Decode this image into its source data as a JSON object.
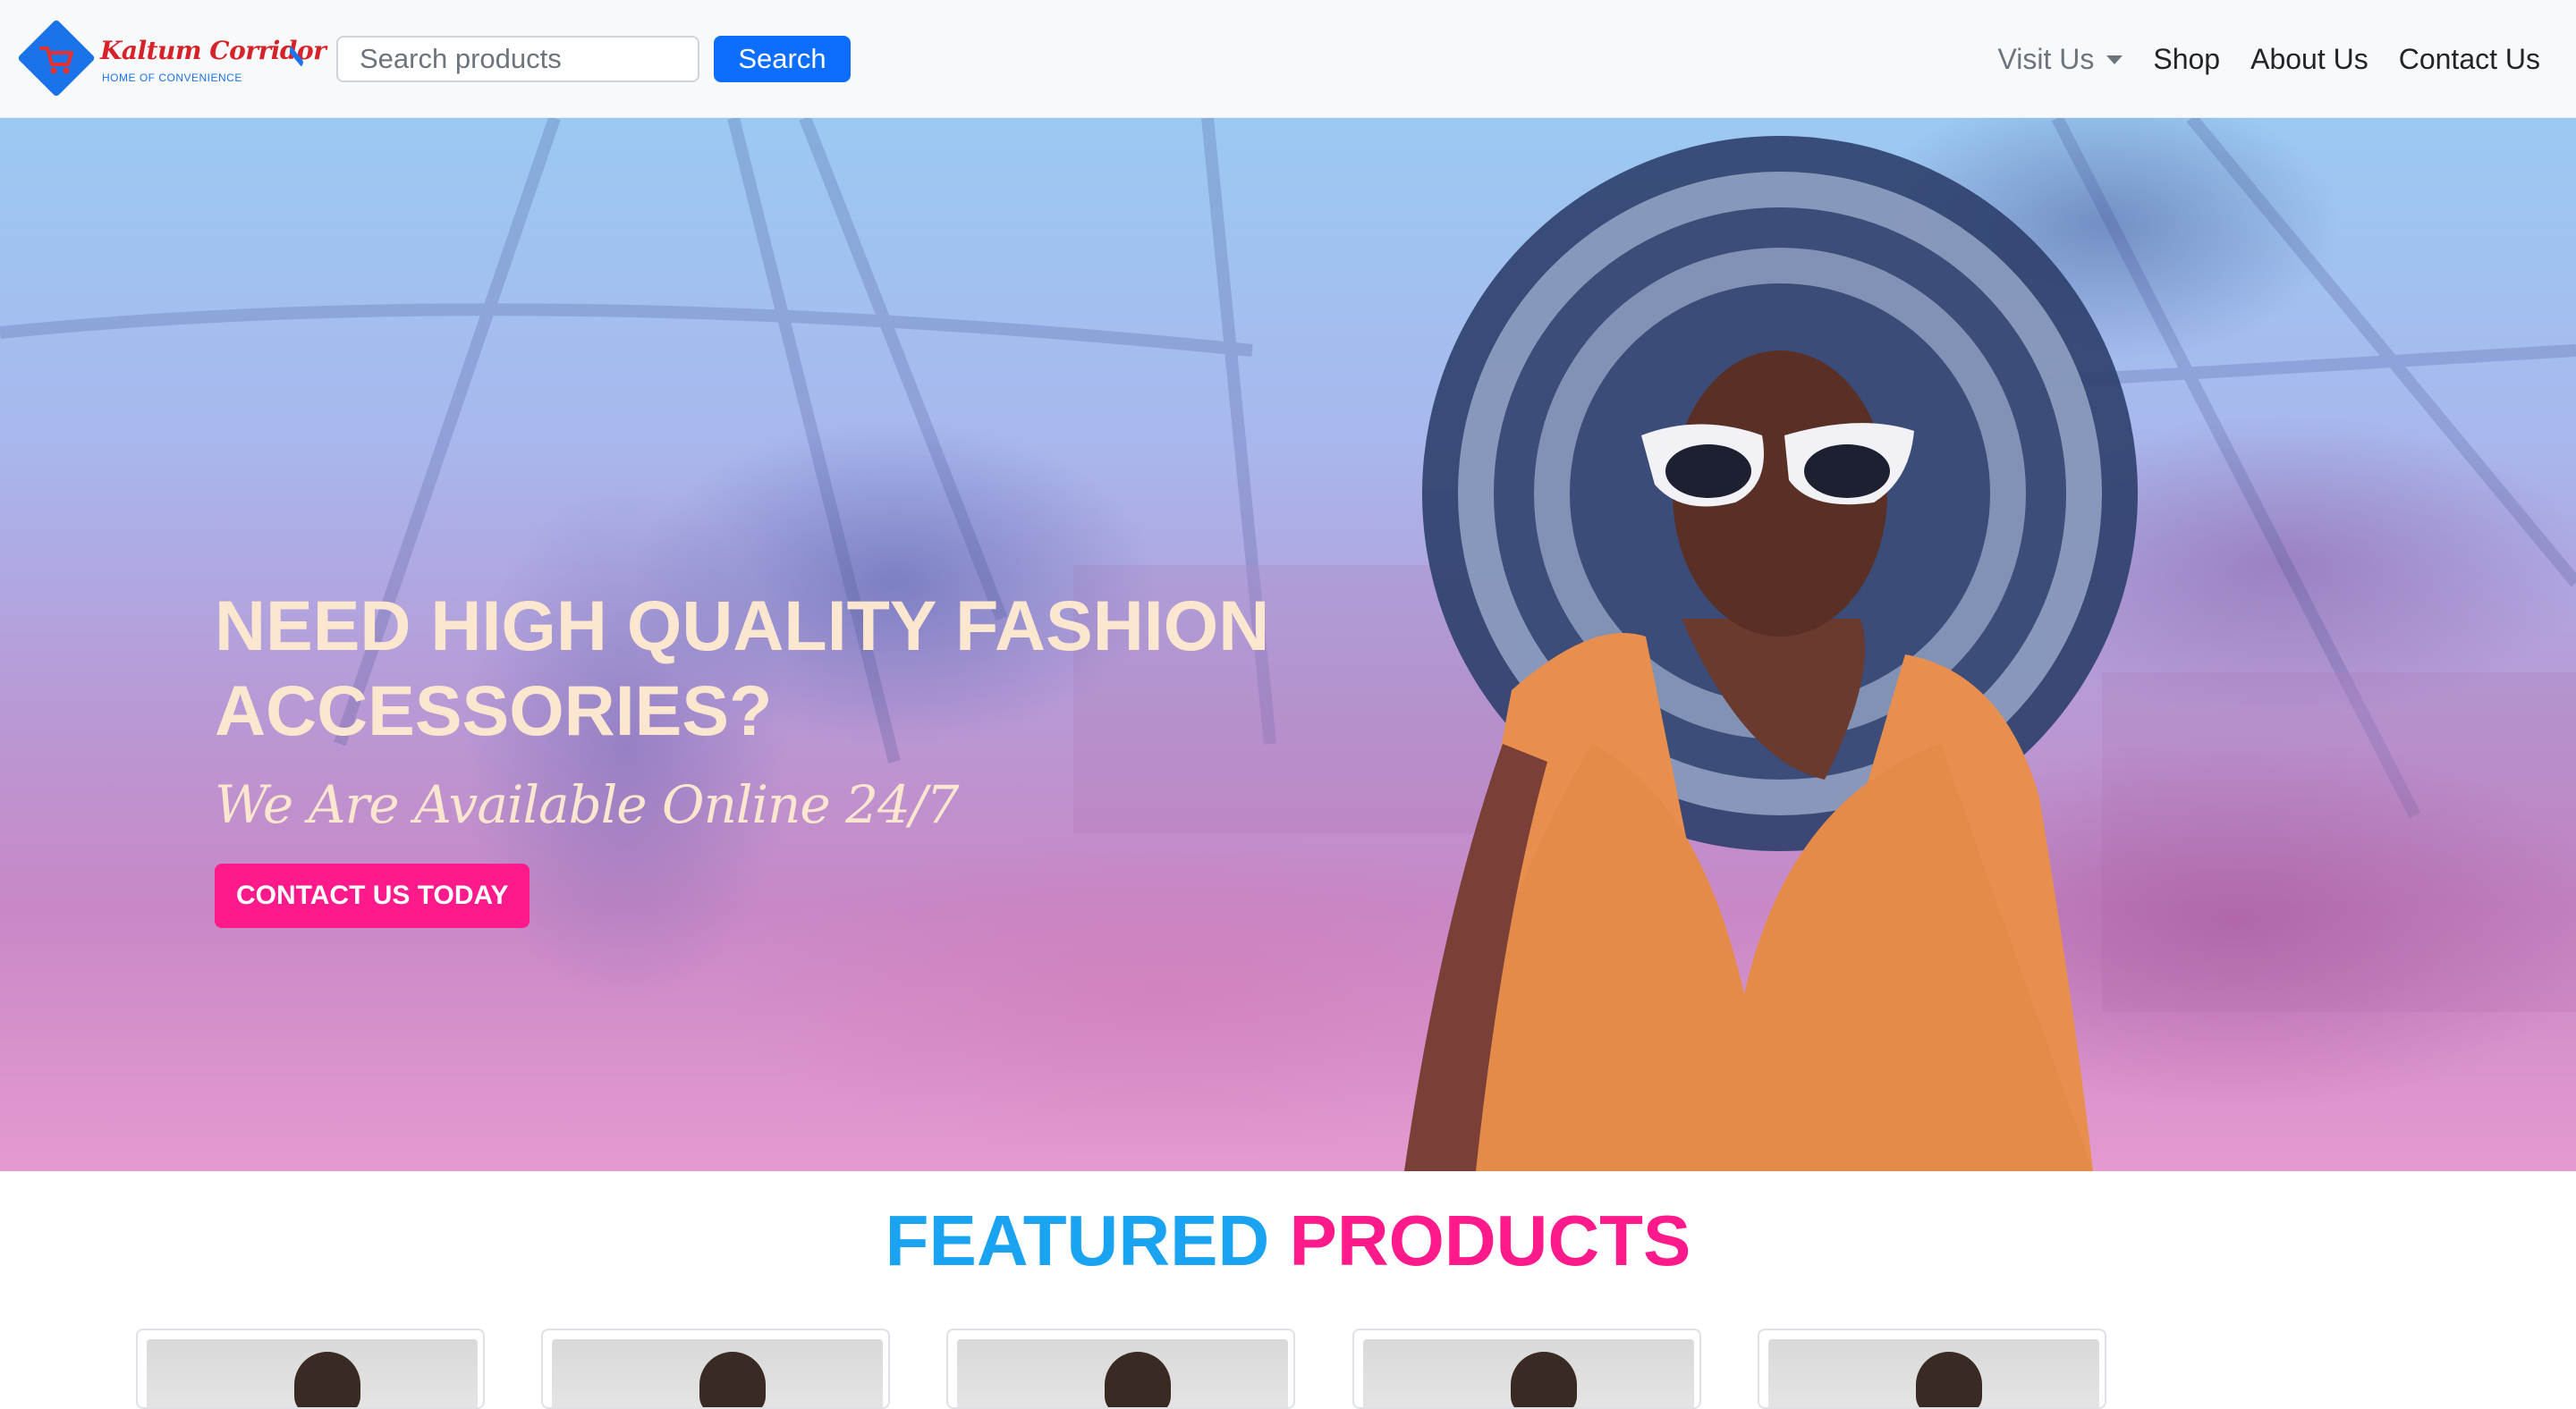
{
  "brand": {
    "name": "Kaltum Corridor",
    "tagline": "HOME OF CONVENIENCE"
  },
  "search": {
    "placeholder": "Search products",
    "button_label": "Search"
  },
  "nav": {
    "visit_us": "Visit Us",
    "shop": "Shop",
    "about_us": "About Us",
    "contact_us": "Contact Us"
  },
  "hero": {
    "title": "NEED HIGH QUALITY FASHION ACCESSORIES?",
    "subtitle": "We Are Available Online 24/7",
    "cta_label": "CONTACT US TODAY"
  },
  "featured": {
    "title_part1": "FEATURED",
    "title_part2": "PRODUCTS"
  },
  "colors": {
    "primary_button": "#0d6efd",
    "accent_pink": "#ff1a8c",
    "accent_blue": "#1aa3f0",
    "brand_red": "#d6232a",
    "hero_text": "#fbe6d0"
  },
  "products": [
    {
      "icon": "person-photo"
    },
    {
      "icon": "person-photo"
    },
    {
      "icon": "person-photo"
    },
    {
      "icon": "person-photo"
    },
    {
      "icon": "person-photo"
    }
  ]
}
